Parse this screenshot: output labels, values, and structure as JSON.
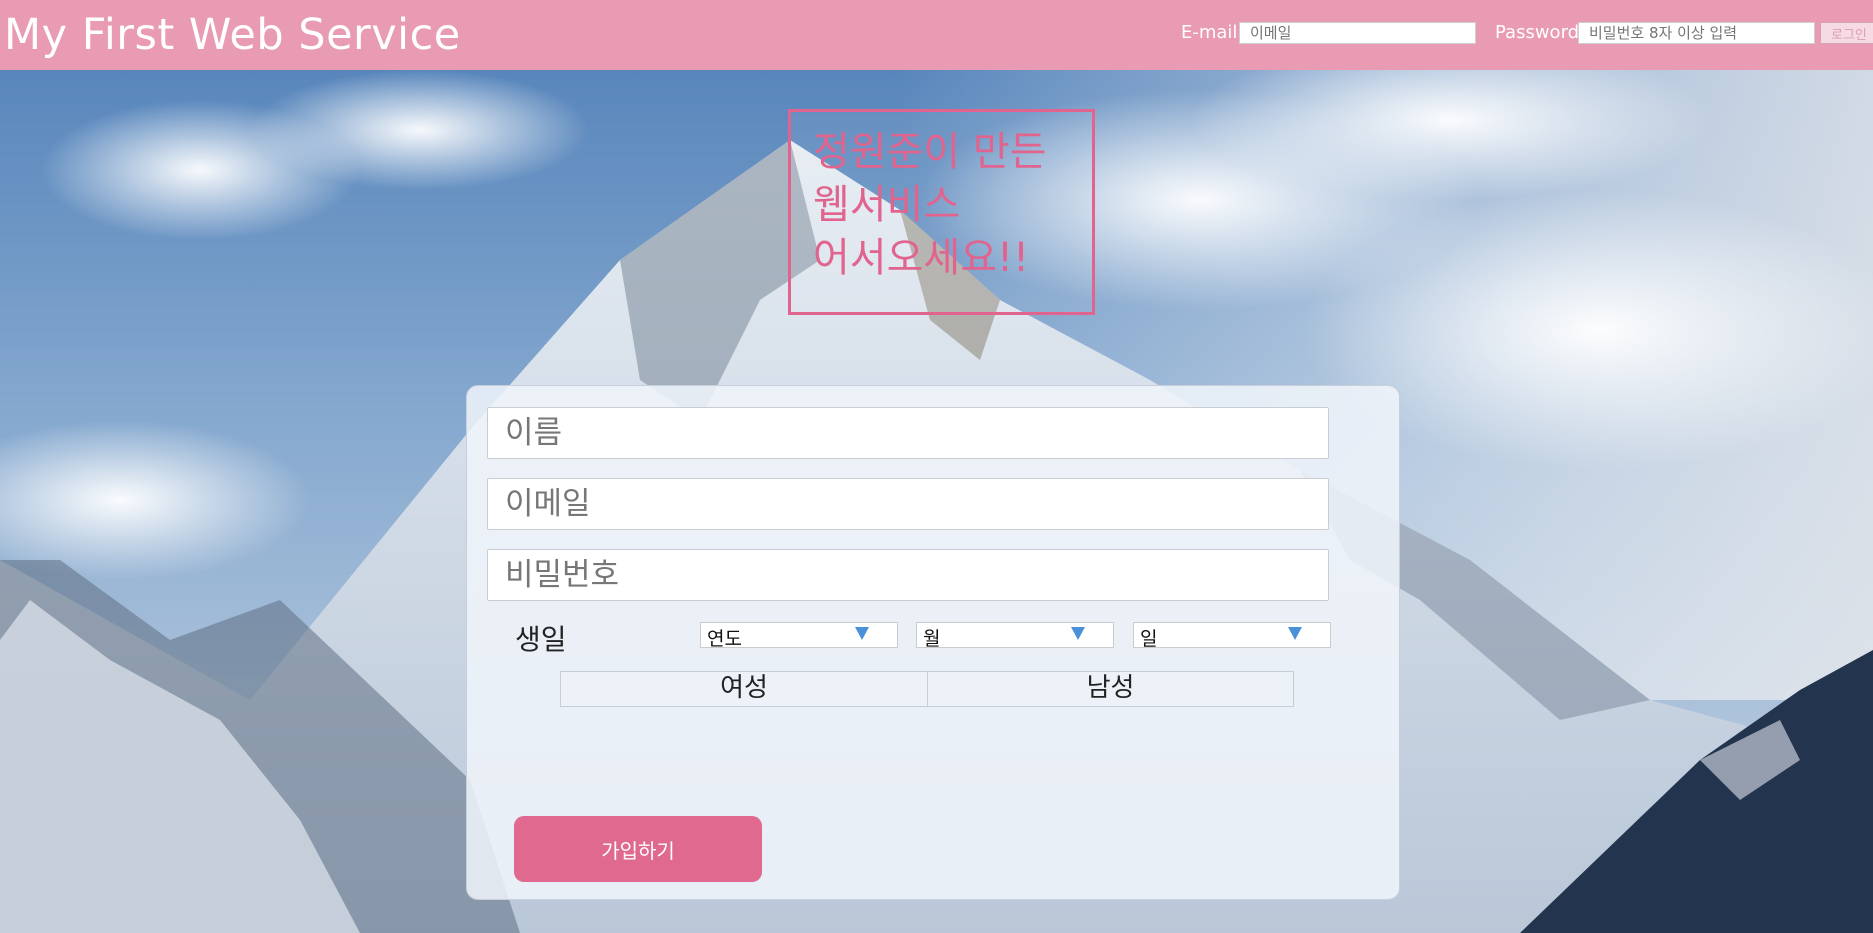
{
  "header": {
    "brand": "My First Web Service",
    "email_label": "E-mail",
    "email_placeholder": "이메일",
    "password_label": "Password",
    "password_placeholder": "비밀번호 8자 이상 입력",
    "login_label": "로그인"
  },
  "welcome": {
    "line1": "정원준이 만든",
    "line2": "웹서비스",
    "line3": "어서오세요!!"
  },
  "signup": {
    "name_placeholder": "이름",
    "email_placeholder": "이메일",
    "password_placeholder": "비밀번호",
    "birthday_label": "생일",
    "year_select": "연도",
    "month_select": "월",
    "day_select": "일",
    "gender_female": "여성",
    "gender_male": "남성",
    "submit_label": "가입하기"
  },
  "colors": {
    "header_bg": "#e89bb2",
    "accent": "#e0648e",
    "button_bg": "#e0698f",
    "select_arrow": "#4a90d9"
  }
}
